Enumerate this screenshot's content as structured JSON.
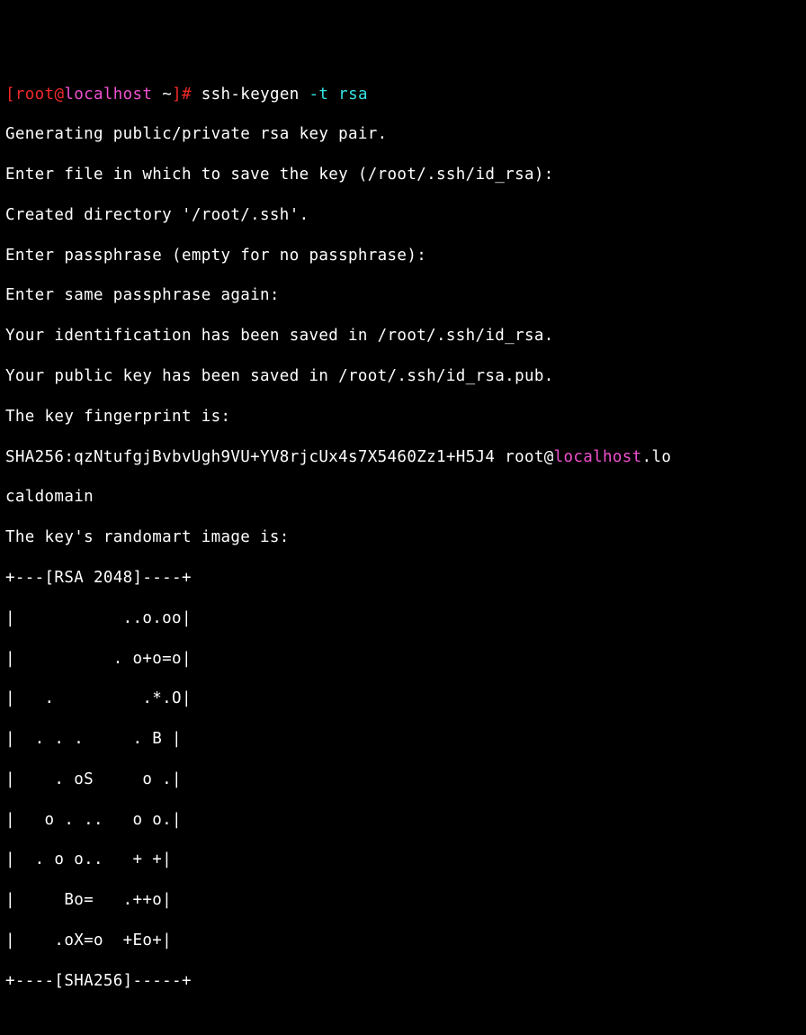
{
  "prompt": {
    "lbracket": "[",
    "user": "root",
    "at": "@",
    "host": "localhost",
    "cwd": " ~",
    "rbracket_hash": "]# ",
    "cmd": "ssh-keygen ",
    "flag": "-t",
    "arg": " rsa"
  },
  "out": {
    "l1": "Generating public/private rsa key pair.",
    "l2": "Enter file in which to save the key (/root/.ssh/id_rsa):",
    "l3": "Created directory '/root/.ssh'.",
    "l4": "Enter passphrase (empty for no passphrase):",
    "l5": "Enter same passphrase again:",
    "l6": "Your identification has been saved in /root/.ssh/id_rsa.",
    "l7": "Your public key has been saved in /root/.ssh/id_rsa.pub.",
    "l8": "The key fingerprint is:",
    "l9a": "SHA256:qzNtufgjBvbvUgh9VU+YV8rjcUx4s7X5460Zz1+H5J4 root@",
    "l9b": "localhost",
    "l9c": ".lo",
    "l10": "caldomain",
    "l11": "The key's randomart image is:"
  },
  "art": {
    "top": "+---[RSA 2048]----+",
    "r1": "|           ..o.oo|",
    "r2": "|          . o+o=o|",
    "r3": "|   .         .*.O|",
    "r4": "|  . . .     . B |",
    "r5": "|    . oS     o .|",
    "r6": "|   o . ..   o o.|",
    "r7": "|  . o o..   + +|",
    "r8": "|     Bo=   .++o|",
    "r9": "|    .oX=o  +Eo+|",
    "bot": "+----[SHA256]-----+"
  }
}
